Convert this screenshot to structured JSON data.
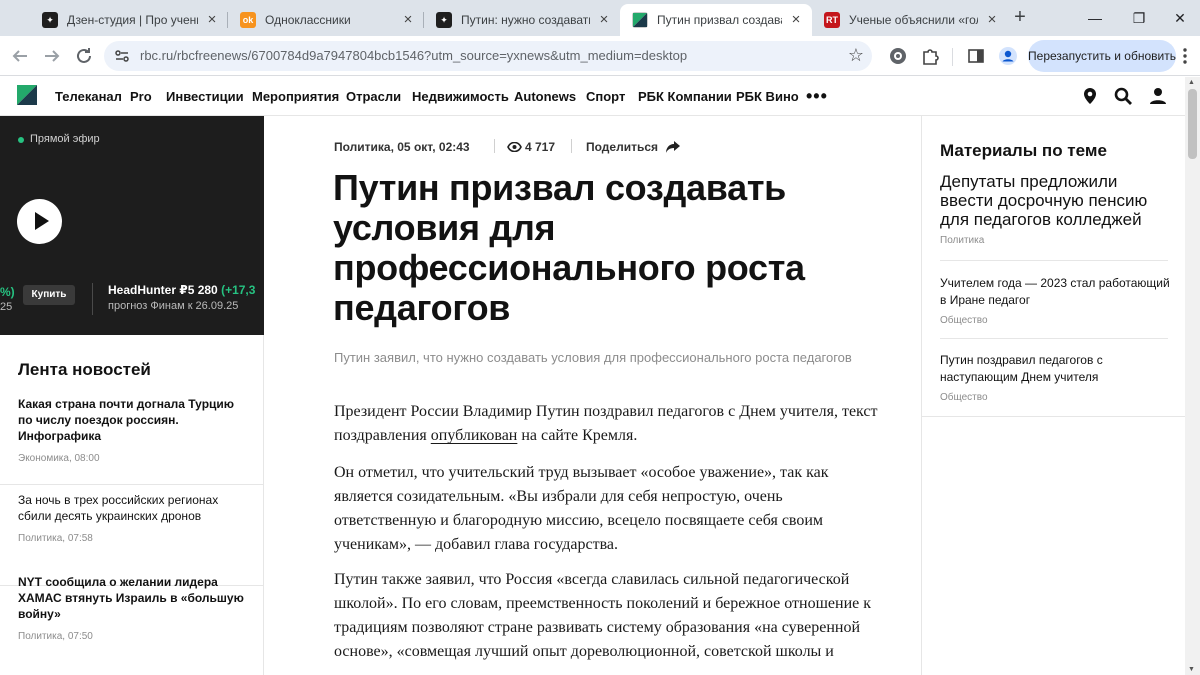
{
  "browser": {
    "tabs": [
      {
        "title": "Дзен-студия | Про ученых и",
        "icon": "dzen-icon"
      },
      {
        "title": "Одноклассники",
        "icon": "odnoklassniki-icon"
      },
      {
        "title": "Путин: нужно создавать ус",
        "icon": "dzen-icon"
      },
      {
        "title": "Путин призвал создавать у",
        "icon": "rbc-icon",
        "active": true
      },
      {
        "title": "Ученые объяснили «голоса",
        "icon": "rt-icon"
      }
    ],
    "new_tab": "+",
    "window_controls": {
      "minimize": "—",
      "maximize": "❐",
      "close": "✕"
    },
    "url": "rbc.ru/rbcfreenews/6700784d9a7947804bcb1546?utm_source=yxnews&utm_medium=desktop",
    "relaunch_label": "Перезапустить и обновить",
    "colors": {
      "tabstrip": "#dde3ea",
      "omnibox": "#edf2fa",
      "relaunch": "#d3e3fd"
    }
  },
  "site": {
    "nav": [
      "Телеканал",
      "Pro",
      "Инвестиции",
      "Мероприятия",
      "Отрасли",
      "Недвижимость",
      "Autonews",
      "Спорт",
      "РБК Компании",
      "РБК Вино"
    ],
    "more": "•••"
  },
  "live": {
    "label": "Прямой эфир",
    "ticker": {
      "pct_fragment": "%)",
      "small_fragment": "25",
      "buy": "Купить",
      "name": "HeadHunter ₽5 280",
      "change": "(+17,3",
      "sub": "прогноз Финам к 26.09.25"
    }
  },
  "feed": {
    "title": "Лента новостей",
    "items": [
      {
        "title": "Какая страна почти догнала Турцию по числу поездок россиян. Инфографика",
        "meta": "Экономика, 08:00",
        "bold": true
      },
      {
        "title": "За ночь в трех российских регионах сбили десять украинских дронов",
        "meta": "Политика, 07:58",
        "bold": false
      },
      {
        "title": "NYT сообщила о желании лидера ХАМАС втянуть Израиль в «большую войну»",
        "meta": "Политика, 07:50",
        "bold": true
      }
    ]
  },
  "article": {
    "category": "Политика, 05 окт, 02:43",
    "views": "4 717",
    "share": "Поделиться",
    "title": "Путин призвал создавать условия для профессионального роста педагогов",
    "subtitle": "Путин заявил, что нужно создавать условия для профессионального роста педагогов",
    "p1_before": "Президент России Владимир Путин поздравил педагогов с Днем учителя, текст поздравления ",
    "p1_link": "опубликован",
    "p1_after": " на сайте Кремля.",
    "p2": "Он отметил, что учительский труд вызывает «особое уважение», так как является созидательным. «Вы избрали для себя непростую, очень ответственную и благородную миссию, всецело посвящаете себя своим ученикам», — добавил глава государства.",
    "p3": "Путин также заявил, что Россия «всегда славилась сильной педагогической школой». По его словам, преемственность поколений и бережное отношение к традициям позволяют стране развивать систему образования «на суверенной основе», «совмещая лучший опыт дореволюционной, советской школы и"
  },
  "related": {
    "title": "Материалы по теме",
    "items": [
      {
        "title": "Депутаты предложили ввести досрочную пенсию для педагогов колледжей",
        "meta": "Политика"
      },
      {
        "title": "Учителем года — 2023 стал работающий в Иране педагог",
        "meta": "Общество"
      },
      {
        "title": "Путин поздравил педагогов с наступающим Днем учителя",
        "meta": "Общество"
      }
    ]
  }
}
